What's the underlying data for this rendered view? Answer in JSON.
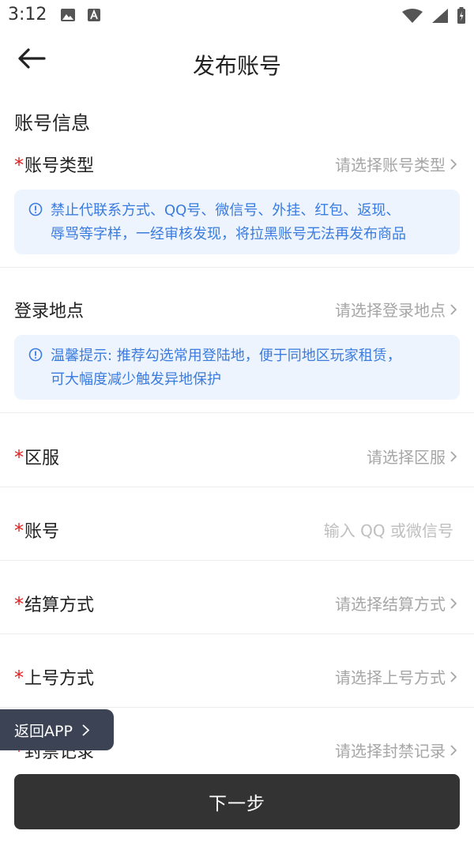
{
  "status_bar": {
    "time": "3:12"
  },
  "header": {
    "title": "发布账号"
  },
  "section": {
    "title": "账号信息"
  },
  "required_mark": "*",
  "fields": [
    {
      "label": "账号类型",
      "placeholder": "请选择账号类型"
    },
    {
      "label": "登录地点",
      "placeholder": "请选择登录地点"
    },
    {
      "label": "区服",
      "placeholder": "请选择区服"
    },
    {
      "label": "账号",
      "placeholder": "输入 QQ 或微信号"
    },
    {
      "label": "结算方式",
      "placeholder": "请选择结算方式"
    },
    {
      "label": "上号方式",
      "placeholder": "请选择上号方式"
    },
    {
      "label": "封禁记录",
      "placeholder": "请选择封禁记录"
    }
  ],
  "notices": [
    {
      "line1": "禁止代联系方式、QQ号、微信号、外挂、红包、返现、",
      "line2": "辱骂等字样，一经审核发现，将拉黑账号无法再发布商品"
    },
    {
      "line1": "温馨提示: 推荐勾选常用登陆地，便于同地区玩家租赁，",
      "line2": "可大幅度减少触发异地保护"
    }
  ],
  "floating": {
    "back_app_label": "返回APP"
  },
  "footer": {
    "next_label": "下一步"
  },
  "colors": {
    "accent_blue": "#3a7be0",
    "notice_bg": "#edf4fd",
    "required_red": "#e02020",
    "button_dark": "#333333"
  }
}
